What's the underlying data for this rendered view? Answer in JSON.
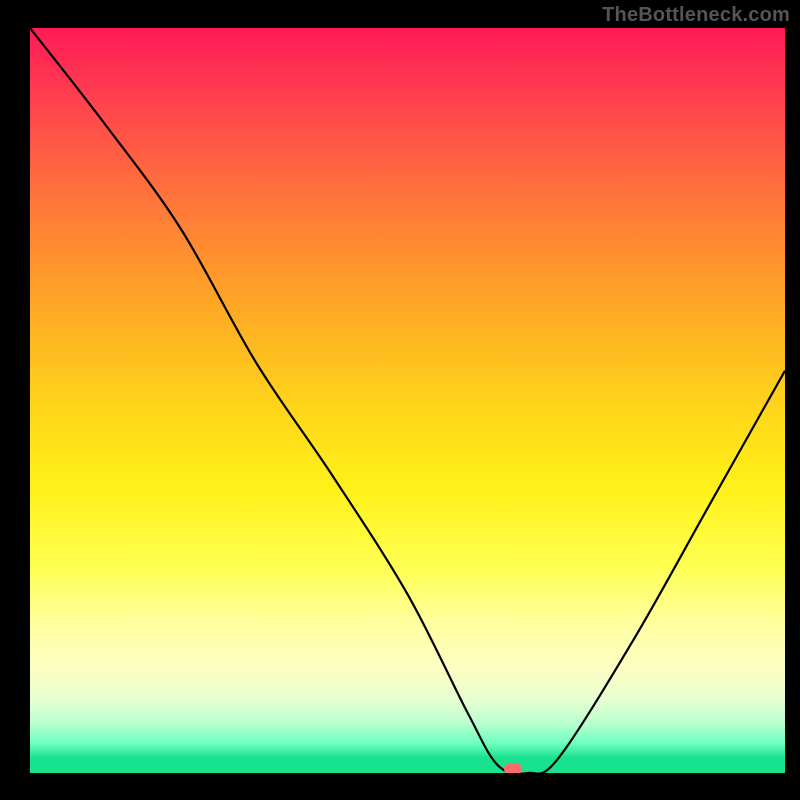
{
  "watermark": "TheBottleneck.com",
  "chart_data": {
    "type": "line",
    "title": "",
    "xlabel": "",
    "ylabel": "",
    "xlim": [
      0,
      100
    ],
    "ylim": [
      0,
      100
    ],
    "grid": false,
    "legend": false,
    "background_gradient": {
      "direction": "vertical",
      "stops": [
        {
          "pct": 0,
          "color": "#ff1a55"
        },
        {
          "pct": 30,
          "color": "#ff8a30"
        },
        {
          "pct": 55,
          "color": "#ffe81a"
        },
        {
          "pct": 80,
          "color": "#ffffa0"
        },
        {
          "pct": 95,
          "color": "#8affc0"
        },
        {
          "pct": 100,
          "color": "#18e28e"
        }
      ]
    },
    "series": [
      {
        "name": "bottleneck-curve",
        "color": "#000000",
        "x": [
          0,
          10,
          20,
          30,
          40,
          50,
          58,
          62,
          66,
          70,
          80,
          90,
          100
        ],
        "values": [
          100,
          87,
          73,
          55,
          40,
          24,
          8,
          1,
          0,
          2,
          18,
          36,
          54
        ]
      }
    ],
    "marker": {
      "name": "optimal-point",
      "x": 64,
      "y": 0,
      "color": "#ff6b6b"
    },
    "annotations": []
  }
}
